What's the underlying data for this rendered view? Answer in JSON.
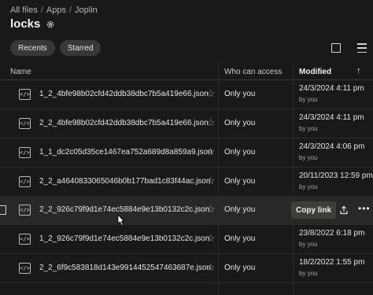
{
  "breadcrumb": [
    "All files",
    "Apps",
    "Joplin"
  ],
  "breadcrumb_sep": "/",
  "title": "locks",
  "chips": [
    "Recents",
    "Starred"
  ],
  "columns": {
    "name": "Name",
    "access": "Who can access",
    "modified": "Modified",
    "sort_arrow": "↑"
  },
  "rows": [
    {
      "name": "1_2_4bfe98b02cfd42ddb38dbc7b5a419e66.json",
      "access": "Only you",
      "date": "24/3/2024 4:11 pm",
      "by": "by you"
    },
    {
      "name": "2_2_4bfe98b02cfd42ddb38dbc7b5a419e66.json",
      "access": "Only you",
      "date": "24/3/2024 4:11 pm",
      "by": "by you"
    },
    {
      "name": "1_1_dc2c05d35ce1467ea752a689d8a859a9.json",
      "access": "Only you",
      "date": "24/3/2024 4:06 pm",
      "by": "by you"
    },
    {
      "name": "2_2_a4640833065046b0b177bad1c83f44ac.json",
      "access": "Only you",
      "date": "20/11/2023 12:59 pm",
      "by": "by you"
    },
    {
      "name": "2_2_926c79f9d1e74ec5884e9e13b0132c2c.json",
      "access": "Only you",
      "date": "",
      "by": ""
    },
    {
      "name": "1_2_926c79f9d1e74ec5884e9e13b0132c2c.json",
      "access": "Only you",
      "date": "23/8/2022 6:18 pm",
      "by": "by you"
    },
    {
      "name": "2_2_6f9c583818d143e9914452547463687e.json",
      "access": "Only you",
      "date": "18/2/2022 1:55 pm",
      "by": "by you"
    }
  ],
  "hover_actions": {
    "copy_link": "Copy link",
    "more": "•••"
  },
  "icons": {
    "settings": "gear-icon",
    "file": "code-file-icon",
    "star": "star-outline-icon",
    "share": "share-icon"
  },
  "colors": {
    "background": "#1a1918",
    "row_hover": "#2a2827",
    "chip": "#3a3836",
    "text": "#e8e6e3"
  }
}
